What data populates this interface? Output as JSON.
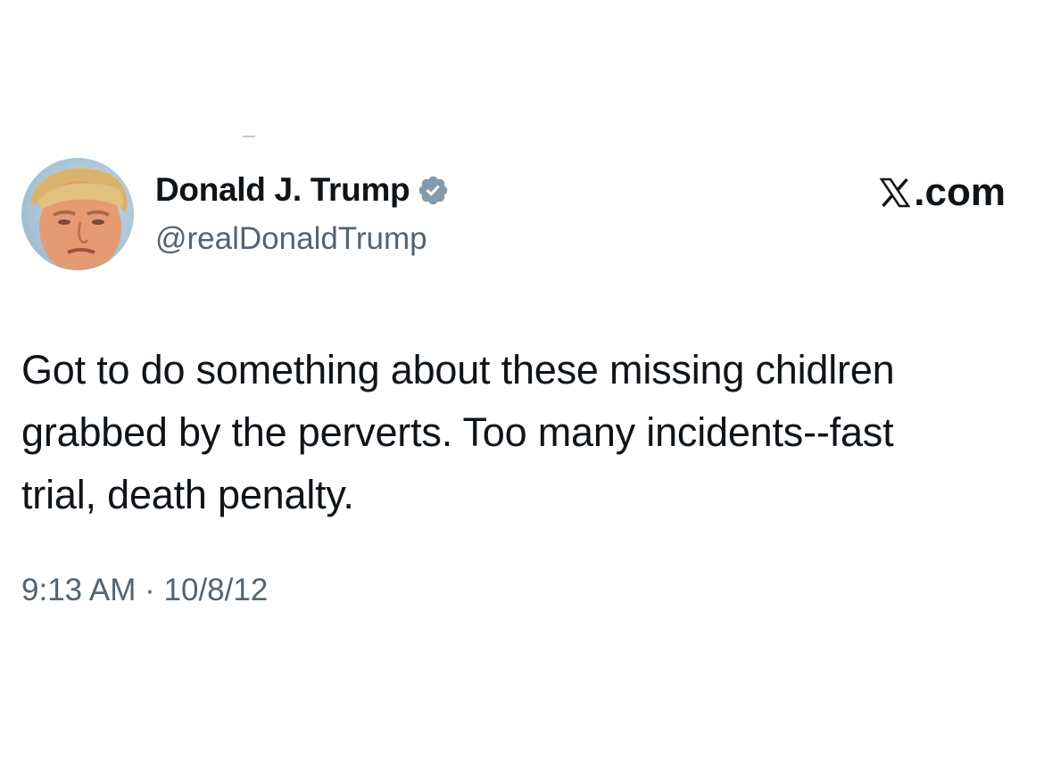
{
  "tweet": {
    "display_name": "Donald J. Trump",
    "handle": "@realDonaldTrump",
    "verified_icon": "verified-badge-icon",
    "brand": {
      "icon": "x-logo-icon",
      "text": ".com"
    },
    "text_lines": [
      "Got to do something about these missing chidlren",
      "grabbed by the perverts. Too many incidents--fast",
      "trial, death penalty."
    ],
    "timestamp": "9:13 AM · 10/8/12"
  },
  "colors": {
    "text_primary": "#0f1419",
    "text_secondary": "#536471",
    "verified_badge": "#829aab",
    "background": "#ffffff"
  }
}
